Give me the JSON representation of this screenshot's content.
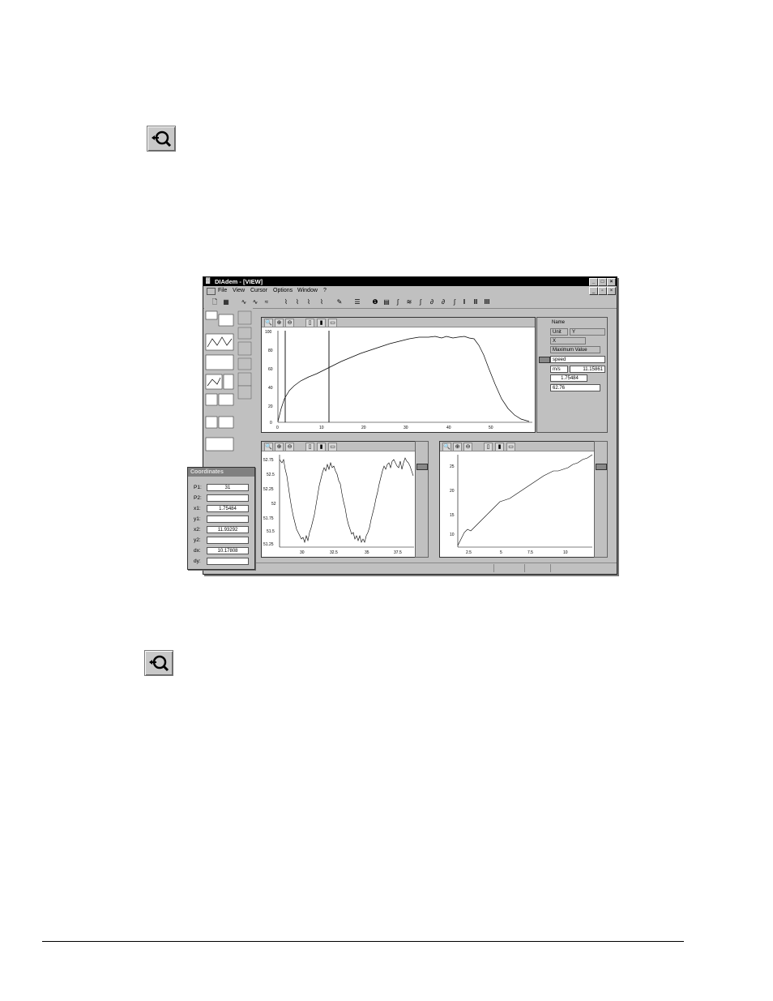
{
  "app": {
    "title": "DIAdem - [VIEW]"
  },
  "menu": [
    "File",
    "View",
    "Cursor",
    "Options",
    "Window",
    "?"
  ],
  "top_pane": {
    "y_ticks": [
      "100",
      "80",
      "60",
      "40",
      "20",
      "0"
    ],
    "x_ticks": [
      "0",
      "10",
      "20",
      "30",
      "40",
      "50"
    ]
  },
  "info_panel": {
    "name_label": "Name",
    "unit_label": "Unit",
    "y_label": "Y",
    "x_label": "X",
    "maxval_label": "Maximum Value",
    "name_value": "speed",
    "unit_value": "m/s",
    "y_value": "11.15861",
    "x_value": "1.75484",
    "max_value": "62.76"
  },
  "bottom_left_pane": {
    "y_ticks": [
      "52.75",
      "52.5",
      "52.25",
      "52",
      "51.75",
      "51.5",
      "51.25"
    ],
    "x_ticks": [
      "30",
      "32.5",
      "35",
      "37.5"
    ]
  },
  "bottom_right_pane": {
    "y_ticks": [
      "25",
      "20",
      "15",
      "10"
    ],
    "x_ticks": [
      "2.5",
      "5",
      "7.5",
      "10"
    ]
  },
  "coordinates": {
    "title": "Coordinates",
    "rows": [
      {
        "key": "P1:",
        "value": "31"
      },
      {
        "key": "P2:",
        "value": ""
      },
      {
        "key": "x1:",
        "value": "1.75484"
      },
      {
        "key": "y1:",
        "value": ""
      },
      {
        "key": "x2:",
        "value": "11.93292"
      },
      {
        "key": "y2:",
        "value": ""
      },
      {
        "key": "dx:",
        "value": "10.17808"
      },
      {
        "key": "dy:",
        "value": ""
      }
    ]
  },
  "icons": {
    "zoom_top": "zoom-magnifier-icon",
    "zoom_bottom": "zoom-magnifier-icon"
  }
}
